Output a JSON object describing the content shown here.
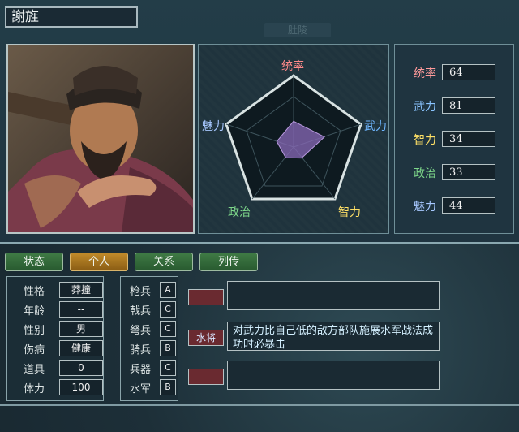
{
  "officer": {
    "name": "謝旌"
  },
  "header": {
    "faint_label": "肚陵"
  },
  "radar": {
    "labels": {
      "command": "统率",
      "war": "武力",
      "intel": "智力",
      "politics": "政治",
      "charm": "魅力"
    },
    "colors": {
      "command": "#ff8a8a",
      "war": "#6fb6ff",
      "intel": "#ffe066",
      "politics": "#7dd68a",
      "charm": "#a7c8ff"
    }
  },
  "stats": [
    {
      "label": "统率",
      "value": "64",
      "color": "#ff9a9a"
    },
    {
      "label": "武力",
      "value": "81",
      "color": "#8ac4ff"
    },
    {
      "label": "智力",
      "value": "34",
      "color": "#ffe066"
    },
    {
      "label": "政治",
      "value": "33",
      "color": "#7dd68a"
    },
    {
      "label": "魅力",
      "value": "44",
      "color": "#a7c8ff"
    }
  ],
  "stat_values_numeric": [
    64,
    81,
    34,
    33,
    44
  ],
  "tabs": [
    "状态",
    "个人",
    "关系",
    "列传"
  ],
  "active_tab": "个人",
  "personal": [
    {
      "k": "性格",
      "v": "莽撞"
    },
    {
      "k": "年龄",
      "v": "--"
    },
    {
      "k": "性别",
      "v": "男"
    },
    {
      "k": "伤病",
      "v": "健康"
    },
    {
      "k": "道具",
      "v": "0"
    },
    {
      "k": "体力",
      "v": "100"
    }
  ],
  "troops": [
    {
      "k": "枪兵",
      "v": "A"
    },
    {
      "k": "戟兵",
      "v": "C"
    },
    {
      "k": "弩兵",
      "v": "C"
    },
    {
      "k": "骑兵",
      "v": "B"
    },
    {
      "k": "兵器",
      "v": "C"
    },
    {
      "k": "水军",
      "v": "B"
    }
  ],
  "skills": [
    {
      "tag": "",
      "desc": ""
    },
    {
      "tag": "水将",
      "desc": "对武力比自己低的敌方部队施展水军战法成功时必暴击"
    },
    {
      "tag": "",
      "desc": ""
    }
  ]
}
